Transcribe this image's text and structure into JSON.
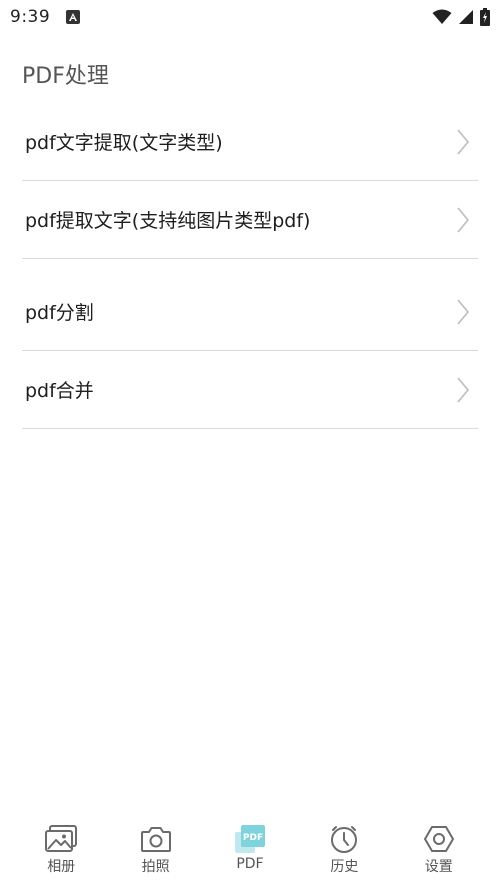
{
  "status": {
    "time": "9:39"
  },
  "page": {
    "title": "PDF处理"
  },
  "menu": [
    {
      "label": "pdf文字提取(文字类型)"
    },
    {
      "label": "pdf提取文字(支持纯图片类型pdf)"
    },
    {
      "label": "pdf分割"
    },
    {
      "label": "pdf合并"
    }
  ],
  "tabs": [
    {
      "label": "相册",
      "icon": "album-icon"
    },
    {
      "label": "拍照",
      "icon": "camera-icon"
    },
    {
      "label": "PDF",
      "icon": "pdf-icon",
      "active": true
    },
    {
      "label": "历史",
      "icon": "history-icon"
    },
    {
      "label": "设置",
      "icon": "settings-icon"
    }
  ],
  "colors": {
    "active_icon": "#7fd3dc",
    "inactive_icon": "#6b6b6b",
    "divider": "#d9d9d9"
  }
}
